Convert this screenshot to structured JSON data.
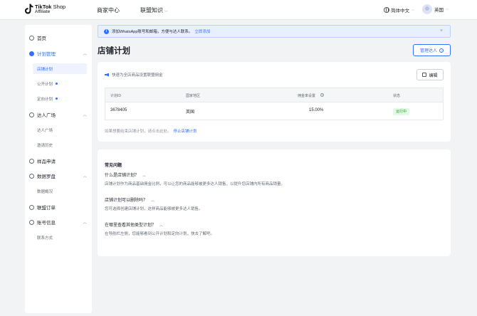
{
  "header": {
    "logo_line1_bold": "TikTok",
    "logo_line1_rest": " Shop",
    "logo_line2": "Affiliate",
    "nav": [
      {
        "label": "商家中心"
      },
      {
        "label": "联盟知识"
      }
    ],
    "language": "简体中文",
    "user_name": "英国"
  },
  "sidebar": {
    "items": [
      {
        "label": "首页"
      },
      {
        "label": "计划管理",
        "subitems": [
          "店铺计划",
          "公开计划",
          "定向计划"
        ]
      },
      {
        "label": "达人广场",
        "subitems": [
          "达人广场",
          "邀请历史"
        ]
      },
      {
        "label": "样品申请"
      },
      {
        "label": "数据罗盘",
        "subitems": [
          "数据概况"
        ]
      },
      {
        "label": "联盟订单"
      },
      {
        "label": "账号信息",
        "subitems": [
          "联系方式"
        ]
      }
    ]
  },
  "banner": {
    "text": "添加WhatsApp账号和邮箱，方便与达人联系。",
    "link": "立即添加",
    "info_glyph": "i",
    "close_glyph": "×"
  },
  "page": {
    "title": "店铺计划",
    "manage_button": "管理达人",
    "manage_glyph": "?"
  },
  "plan_card": {
    "hint": "快速为全店商品设置联盟佣金",
    "edit_button": "编辑",
    "table": {
      "headers": [
        "计划ID",
        "国家地区",
        "佣金率设置",
        "状态"
      ],
      "row": {
        "id": "3678405",
        "region": "英国",
        "commission": "15.00%",
        "status": "运行中"
      }
    },
    "note": "如果想要结束店铺计划，请点击此处。",
    "note_link": "停止店铺计划"
  },
  "faq": {
    "title": "常见问题",
    "items": [
      {
        "q": "什么是店铺计划？",
        "a": "店铺计划作为商品基础佣金比例，可以让您的商品能够被更多达人销售，以提升您店铺内所有商品销量。"
      },
      {
        "q": "店铺计划可以删除吗？",
        "a": "您可选择创建店铺计划，这样商品能够被更多达人销售。"
      },
      {
        "q": "在哪里查看其他类型计划？",
        "a": "在导航栏左侧，您能够看到公开计划和定向计划，快去了解吧。"
      }
    ]
  }
}
